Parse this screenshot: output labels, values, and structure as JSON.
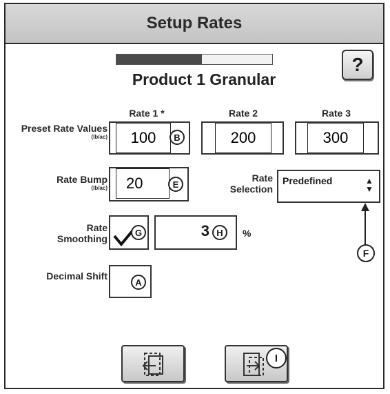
{
  "title": "Setup Rates",
  "help_label": "?",
  "product": {
    "name": "Product 1 Granular",
    "progress": 0.55
  },
  "preset": {
    "label": "Preset Rate Values",
    "unit": "(lb/ac)",
    "headers": [
      "Rate 1 *",
      "Rate 2",
      "Rate 3"
    ],
    "values": [
      "100",
      "200",
      "300"
    ],
    "marker": "B"
  },
  "bump": {
    "label": "Rate Bump",
    "unit": "(lb/ac)",
    "value": "20",
    "marker": "E"
  },
  "selection": {
    "label_line1": "Rate",
    "label_line2": "Selection",
    "value": "Predefined",
    "marker": "F"
  },
  "smoothing": {
    "label_line1": "Rate",
    "label_line2": "Smoothing",
    "checked": true,
    "check_marker": "G",
    "value": "3",
    "value_marker": "H",
    "unit": "%"
  },
  "decimal": {
    "label": "Decimal Shift",
    "marker": "A"
  },
  "footer": {
    "next_marker": "I"
  }
}
